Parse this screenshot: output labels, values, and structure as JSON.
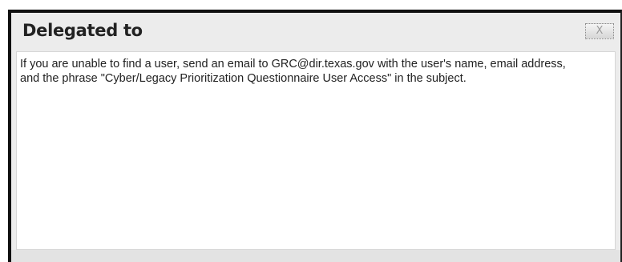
{
  "dialog": {
    "title": "Delegated to",
    "close_label": "X",
    "message": "If you are unable to find a user, send an email to GRC@dir.texas.gov with the user's name, email address, and the phrase \"Cyber/Legacy Prioritization Questionnaire User Access\" in the subject."
  }
}
